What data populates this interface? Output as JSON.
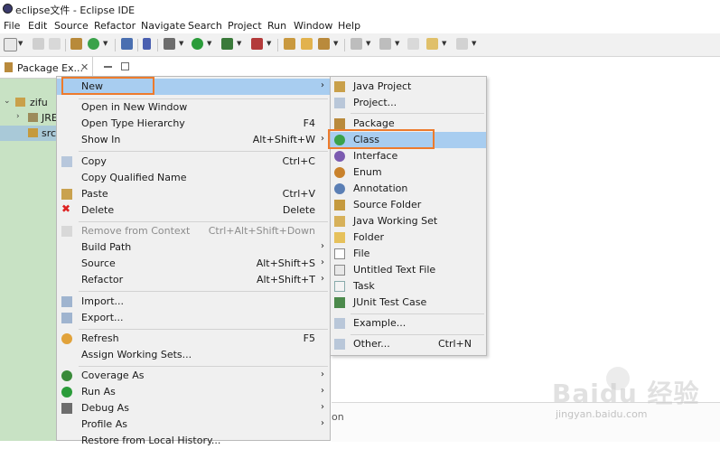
{
  "window": {
    "title": "eclipse文件 - Eclipse IDE"
  },
  "menubar": [
    "File",
    "Edit",
    "Source",
    "Refactor",
    "Navigate",
    "Search",
    "Project",
    "Run",
    "Window",
    "Help"
  ],
  "view_tab": {
    "label": "Package Ex...",
    "close": "✕"
  },
  "tree": [
    {
      "label": "zifu",
      "expanded": true
    },
    {
      "label": "JRE"
    },
    {
      "label": "src"
    }
  ],
  "context_menu": {
    "new": {
      "label": "New"
    },
    "open_new_window": {
      "label": "Open in New Window"
    },
    "open_type_hierarchy": {
      "label": "Open Type Hierarchy",
      "shortcut": "F4"
    },
    "show_in": {
      "label": "Show In",
      "shortcut": "Alt+Shift+W"
    },
    "copy": {
      "label": "Copy",
      "shortcut": "Ctrl+C"
    },
    "copy_qualified": {
      "label": "Copy Qualified Name"
    },
    "paste": {
      "label": "Paste",
      "shortcut": "Ctrl+V"
    },
    "delete": {
      "label": "Delete",
      "shortcut": "Delete"
    },
    "remove_context": {
      "label": "Remove from Context",
      "shortcut": "Ctrl+Alt+Shift+Down"
    },
    "build_path": {
      "label": "Build Path"
    },
    "source": {
      "label": "Source",
      "shortcut": "Alt+Shift+S"
    },
    "refactor": {
      "label": "Refactor",
      "shortcut": "Alt+Shift+T"
    },
    "import": {
      "label": "Import..."
    },
    "export": {
      "label": "Export..."
    },
    "refresh": {
      "label": "Refresh",
      "shortcut": "F5"
    },
    "assign_working_sets": {
      "label": "Assign Working Sets..."
    },
    "coverage_as": {
      "label": "Coverage As"
    },
    "run_as": {
      "label": "Run As"
    },
    "debug_as": {
      "label": "Debug As"
    },
    "profile_as": {
      "label": "Profile As"
    },
    "restore_history": {
      "label": "Restore from Local History..."
    }
  },
  "submenu": {
    "java_project": "Java Project",
    "project": "Project...",
    "package": "Package",
    "class": "Class",
    "interface": "Interface",
    "enum": "Enum",
    "annotation": "Annotation",
    "source_folder": "Source Folder",
    "java_working_set": "Java Working Set",
    "folder": "Folder",
    "file": "File",
    "untitled_text_file": "Untitled Text File",
    "task": "Task",
    "junit_test_case": "JUnit Test Case",
    "example": "Example...",
    "other": {
      "label": "Other...",
      "shortcut": "Ctrl+N"
    }
  },
  "bottom_panel": {
    "hint": "on"
  },
  "watermark": {
    "brand": "Baidu 经验",
    "url": "jingyan.baidu.com"
  },
  "colors": {
    "highlight": "#a8cdf0",
    "callout": "#ed7b2c",
    "explorer_bg": "#c8e2c4"
  }
}
